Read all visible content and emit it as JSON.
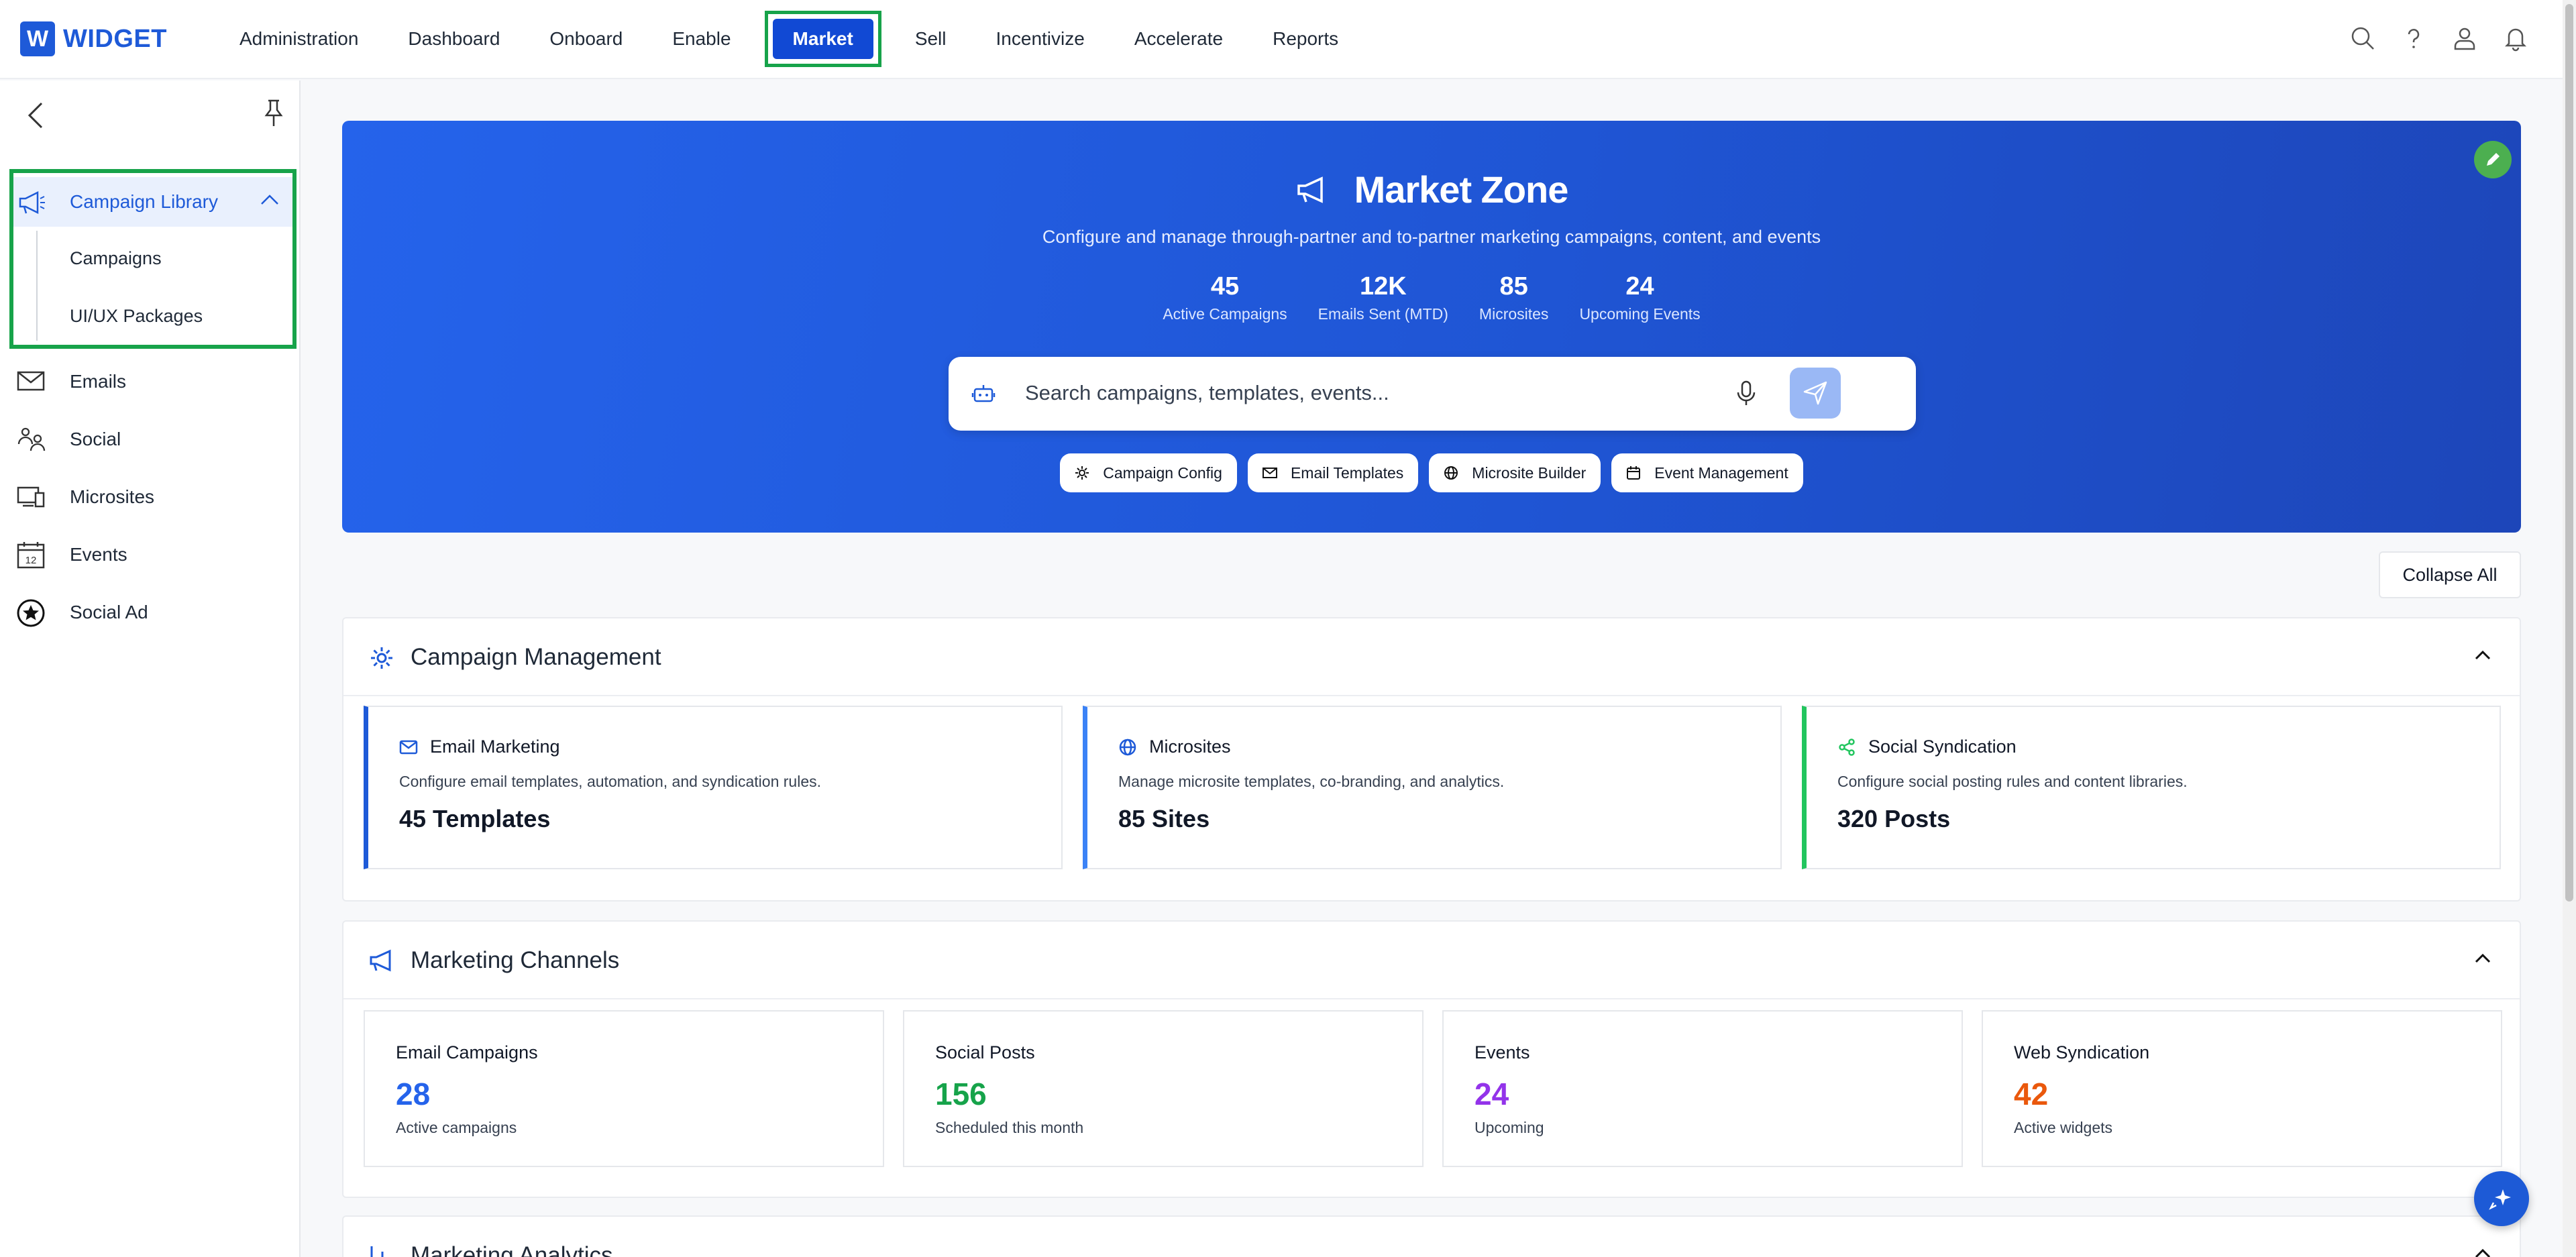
{
  "brand": {
    "logo_letter": "W",
    "name": "WIDGET",
    "color": "#1e5ad8"
  },
  "nav": {
    "items": [
      "Administration",
      "Dashboard",
      "Onboard",
      "Enable",
      "Market",
      "Sell",
      "Incentivize",
      "Accelerate",
      "Reports"
    ],
    "active": "Market",
    "icons": [
      "search-icon",
      "help-icon",
      "user-icon",
      "bell-icon"
    ]
  },
  "sidebar": {
    "group": {
      "label": "Campaign Library",
      "icon": "megaphone-icon",
      "children": [
        "Campaigns",
        "UI/UX Packages"
      ]
    },
    "items": [
      {
        "label": "Emails",
        "icon": "envelope-icon"
      },
      {
        "label": "Social",
        "icon": "social-icon"
      },
      {
        "label": "Microsites",
        "icon": "devices-icon"
      },
      {
        "label": "Events",
        "icon": "calendar-icon",
        "icon_text": "12"
      },
      {
        "label": "Social Ad",
        "icon": "star-badge-icon"
      }
    ]
  },
  "hero": {
    "title": "Market Zone",
    "subtitle": "Configure and manage through-partner and to-partner marketing campaigns, content, and events",
    "stats": [
      {
        "value": "45",
        "label": "Active Campaigns"
      },
      {
        "value": "12K",
        "label": "Emails Sent (MTD)"
      },
      {
        "value": "85",
        "label": "Microsites"
      },
      {
        "value": "24",
        "label": "Upcoming Events"
      }
    ],
    "search_placeholder": "Search campaigns, templates, events...",
    "chips": [
      {
        "label": "Campaign Config",
        "icon": "gear-icon"
      },
      {
        "label": "Email Templates",
        "icon": "envelope-icon"
      },
      {
        "label": "Microsite Builder",
        "icon": "globe-icon"
      },
      {
        "label": "Event Management",
        "icon": "calendar-icon"
      }
    ]
  },
  "collapse_all": "Collapse All",
  "campaign_management": {
    "title": "Campaign Management",
    "cards": [
      {
        "title": "Email Marketing",
        "desc": "Configure email templates, automation, and syndication rules.",
        "value": "45 Templates",
        "accent": "#1e5ad8"
      },
      {
        "title": "Microsites",
        "desc": "Manage microsite templates, co-branding, and analytics.",
        "value": "85 Sites",
        "accent": "#3b82f6"
      },
      {
        "title": "Social Syndication",
        "desc": "Configure social posting rules and content libraries.",
        "value": "320 Posts",
        "accent": "#22c55e"
      }
    ]
  },
  "marketing_channels": {
    "title": "Marketing Channels",
    "cards": [
      {
        "label": "Email Campaigns",
        "value": "28",
        "sub": "Active campaigns",
        "color": "#2563eb"
      },
      {
        "label": "Social Posts",
        "value": "156",
        "sub": "Scheduled this month",
        "color": "#16a34a"
      },
      {
        "label": "Events",
        "value": "24",
        "sub": "Upcoming",
        "color": "#9333ea"
      },
      {
        "label": "Web Syndication",
        "value": "42",
        "sub": "Active widgets",
        "color": "#ea580c"
      }
    ]
  },
  "marketing_analytics": {
    "title": "Marketing Analytics"
  }
}
